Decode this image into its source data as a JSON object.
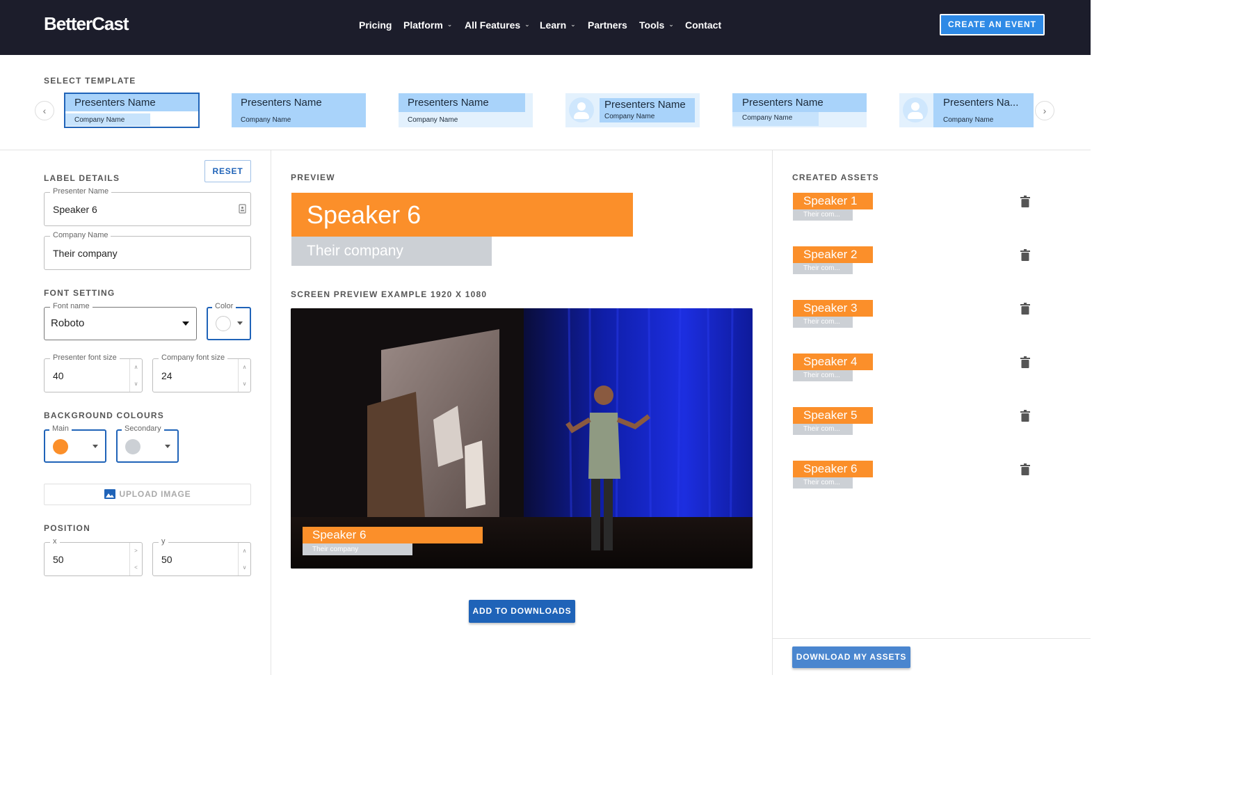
{
  "header": {
    "logo": "BetterCast",
    "nav": [
      {
        "label": "Pricing",
        "dropdown": false
      },
      {
        "label": "Platform",
        "dropdown": true
      },
      {
        "label": "All Features",
        "dropdown": true
      },
      {
        "label": "Learn",
        "dropdown": true
      },
      {
        "label": "Partners",
        "dropdown": false
      },
      {
        "label": "Tools",
        "dropdown": true
      },
      {
        "label": "Contact",
        "dropdown": false
      }
    ],
    "cta": "CREATE AN EVENT"
  },
  "templates": {
    "title": "SELECT TEMPLATE",
    "items": [
      {
        "name": "Presenters Name",
        "company": "Company Name",
        "selected": true
      },
      {
        "name": "Presenters Name",
        "company": "Company Name"
      },
      {
        "name": "Presenters Name",
        "company": "Company Name"
      },
      {
        "name": "Presenters Name",
        "company": "Company Name",
        "avatar": true
      },
      {
        "name": "Presenters Name",
        "company": "Company Name"
      },
      {
        "name": "Presenters Na...",
        "company": "Company Name",
        "avatar": true
      }
    ]
  },
  "label_details": {
    "title": "LABEL DETAILS",
    "reset": "RESET",
    "presenter_label": "Presenter Name",
    "presenter_value": "Speaker 6",
    "company_label": "Company Name",
    "company_value": "Their company"
  },
  "font_setting": {
    "title": "FONT SETTING",
    "font_label": "Font name",
    "font_value": "Roboto",
    "color_label": "Color",
    "presenter_size_label": "Presenter font size",
    "presenter_size": "40",
    "company_size_label": "Company font size",
    "company_size": "24"
  },
  "background": {
    "title": "BACKGROUND COLOURS",
    "main_label": "Main",
    "secondary_label": "Secondary",
    "upload": "UPLOAD IMAGE"
  },
  "position": {
    "title": "POSITION",
    "x_label": "x",
    "x_value": "50",
    "y_label": "y",
    "y_value": "50"
  },
  "preview": {
    "title": "PREVIEW",
    "name": "Speaker 6",
    "company": "Their company",
    "screen_title": "SCREEN PREVIEW EXAMPLE 1920 X 1080",
    "add_button": "ADD TO DOWNLOADS"
  },
  "assets": {
    "title": "CREATED ASSETS",
    "items": [
      {
        "name": "Speaker 1",
        "company": "Their com..."
      },
      {
        "name": "Speaker 2",
        "company": "Their com..."
      },
      {
        "name": "Speaker 3",
        "company": "Their com..."
      },
      {
        "name": "Speaker 4",
        "company": "Their com..."
      },
      {
        "name": "Speaker 5",
        "company": "Their com..."
      },
      {
        "name": "Speaker 6",
        "company": "Their com..."
      }
    ],
    "download": "DOWNLOAD MY ASSETS"
  },
  "colors": {
    "brand_blue": "#1f63b8",
    "header_bg": "#1c1d2b",
    "cta_blue": "#2e8ae6",
    "label_orange": "#fb8f2a",
    "label_grey": "#ccd0d5",
    "template_blue": "#a9d3fa"
  }
}
